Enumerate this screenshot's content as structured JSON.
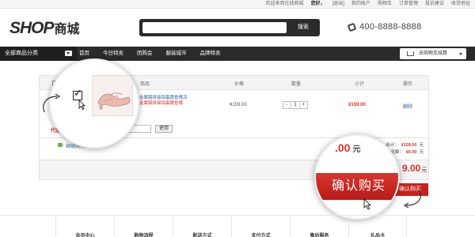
{
  "topbar": {
    "welcome": "欢迎来到在线商城",
    "hello": "您好，",
    "links": [
      "[退出]",
      "我的账户",
      "购物车",
      "订单管理",
      "投诉建议",
      "收货地址"
    ]
  },
  "logo": {
    "part1": "SHOP",
    "part2": "商城"
  },
  "search": {
    "placeholder": "",
    "button": "搜索"
  },
  "phone": "400-8888-8888",
  "nav": {
    "category": "全部商品分类",
    "items": [
      "首页",
      "今日特卖",
      "团购会",
      "服装城市",
      "品牌特卖"
    ],
    "cart_button": "去购物车结算"
  },
  "cart": {
    "headers": {
      "product": "商品",
      "price": "价格",
      "quantity": "数量",
      "subtotal": "小计",
      "action": "操作"
    },
    "item": {
      "name_line1": "色超模蝴蝶结金属膜拼接铝蛋跟鱼嘴凉",
      "name_line2": "色超模蝴蝶结金属膜拼接铝蛋跟鱼嘴",
      "price": "¥159.00",
      "qty": "1",
      "subtotal": "¥159.00",
      "delete": "删除"
    },
    "coupon_label": "代金券或到",
    "coupon_use": "使用",
    "continue": "继续购物",
    "totals": [
      {
        "label": "合计：",
        "value": "¥159.00",
        "unit": "元"
      },
      {
        "label": "运费：",
        "value": "¥0.00",
        "unit": "元"
      }
    ],
    "grand_total": "9.00",
    "grand_unit": "元",
    "confirm_small": "确认购买"
  },
  "magnifier": {
    "confirm_big": "确认购买",
    "price_fragment": "00"
  },
  "footer": [
    "会员中心",
    "购物流程",
    "配送方式",
    "支付方式",
    "售后服务",
    "礼品卡"
  ]
}
